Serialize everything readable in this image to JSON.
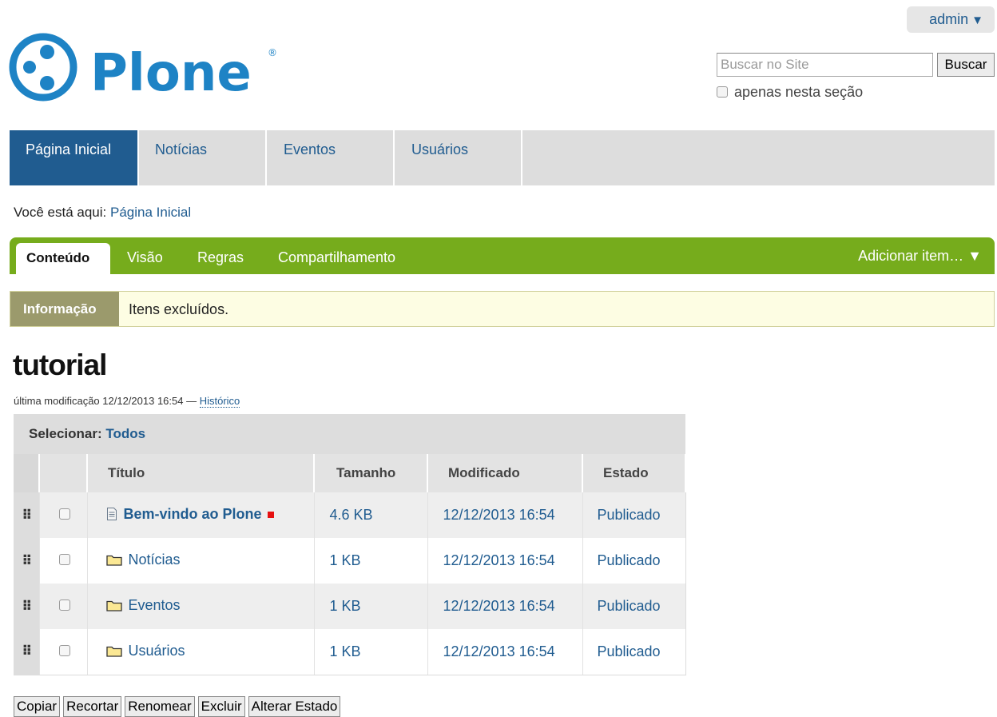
{
  "personal_bar": {
    "user": "admin",
    "arrow": "▼"
  },
  "logo": {
    "text": "Plone",
    "mark": "®",
    "color": "#1e83c5"
  },
  "search": {
    "placeholder": "Buscar no Site",
    "value": "",
    "button": "Buscar",
    "section_only_label": "apenas nesta seção",
    "section_only_checked": false
  },
  "global_nav": [
    {
      "label": "Página Inicial",
      "selected": true
    },
    {
      "label": "Notícias",
      "selected": false
    },
    {
      "label": "Eventos",
      "selected": false
    },
    {
      "label": "Usuários",
      "selected": false
    }
  ],
  "breadcrumbs": {
    "prefix": "Você está aqui:",
    "items": [
      "Página Inicial"
    ]
  },
  "edit_bar": {
    "tabs": [
      "Conteúdo",
      "Visão",
      "Regras",
      "Compartilhamento"
    ],
    "active_tab": "Conteúdo",
    "add_item": "Adicionar item… ▼",
    "color": "#76ac1c"
  },
  "message": {
    "type": "Informação",
    "text": "Itens excluídos."
  },
  "page": {
    "title": "tutorial",
    "byline_prefix": "última modificação 12/12/2013 16:54 —",
    "history_link": "Histórico"
  },
  "listing": {
    "select_label": "Selecionar:",
    "select_all": "Todos",
    "columns": [
      "Título",
      "Tamanho",
      "Modificado",
      "Estado"
    ],
    "rows": [
      {
        "title": "Bem-vindo ao Plone",
        "icon": "document-icon",
        "size": "4.6 KB",
        "modified": "12/12/2013 16:54",
        "state": "Publicado",
        "locked": true,
        "bold": true
      },
      {
        "title": "Notícias",
        "icon": "folder-icon",
        "size": "1 KB",
        "modified": "12/12/2013 16:54",
        "state": "Publicado",
        "locked": false,
        "bold": false
      },
      {
        "title": "Eventos",
        "icon": "folder-icon",
        "size": "1 KB",
        "modified": "12/12/2013 16:54",
        "state": "Publicado",
        "locked": false,
        "bold": false
      },
      {
        "title": "Usuários",
        "icon": "folder-icon",
        "size": "1 KB",
        "modified": "12/12/2013 16:54",
        "state": "Publicado",
        "locked": false,
        "bold": false
      }
    ]
  },
  "actions": [
    "Copiar",
    "Recortar",
    "Renomear",
    "Excluir",
    "Alterar Estado"
  ],
  "drag_handle_glyph": "⠿"
}
